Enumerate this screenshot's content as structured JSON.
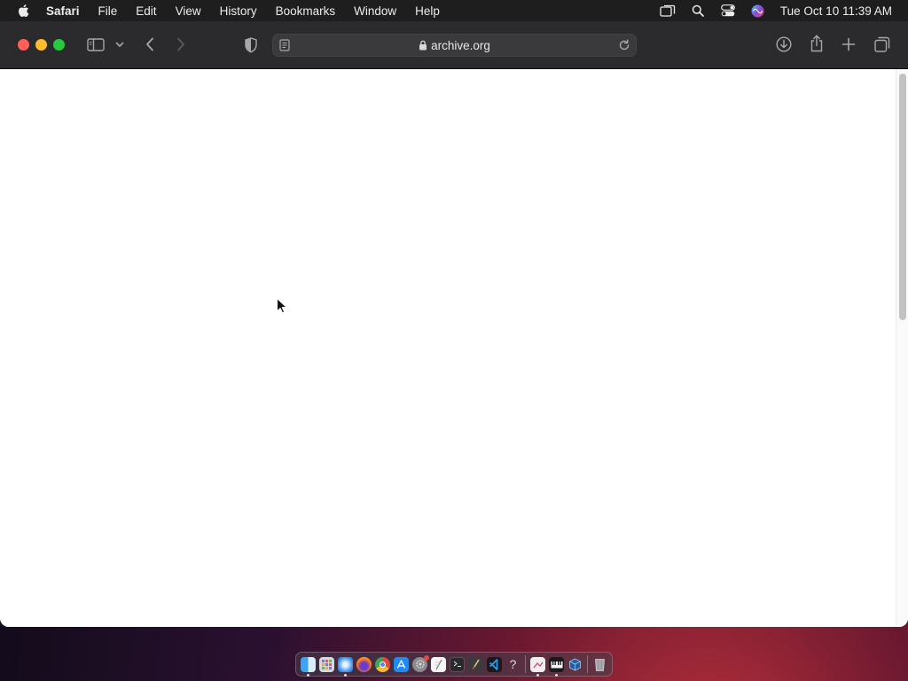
{
  "menubar": {
    "app_name": "Safari",
    "items": [
      "File",
      "Edit",
      "View",
      "History",
      "Bookmarks",
      "Window",
      "Help"
    ],
    "clock": "Tue Oct 10  11:39 AM",
    "status_icons": [
      "screen-mirroring-icon",
      "spotlight-search-icon",
      "control-center-icon",
      "siri-icon"
    ]
  },
  "toolbar": {
    "url": "archive.org",
    "icons": [
      "sidebar-icon",
      "tab-group-chevron-icon",
      "back-icon",
      "forward-icon",
      "privacy-shield-icon",
      "reader-icon",
      "lock-icon",
      "reload-icon",
      "downloads-icon",
      "share-icon",
      "new-tab-icon",
      "tab-overview-icon"
    ]
  },
  "colors": {
    "close": "#fe5f57",
    "minimize": "#febc2e",
    "maximize": "#28c840",
    "toolbar_bg": "#2b2a2c",
    "menubar_bg": "#1e1e1f"
  },
  "dock": {
    "apps": [
      "Finder",
      "Launchpad",
      "Safari",
      "Firefox",
      "Chrome",
      "App Store",
      "System Preferences",
      "TextEdit",
      "Terminal",
      "Script Editor",
      "Visual Studio Code",
      "Help Viewer",
      "Preview",
      "Piano",
      "VirtualBox",
      "Trash"
    ]
  }
}
